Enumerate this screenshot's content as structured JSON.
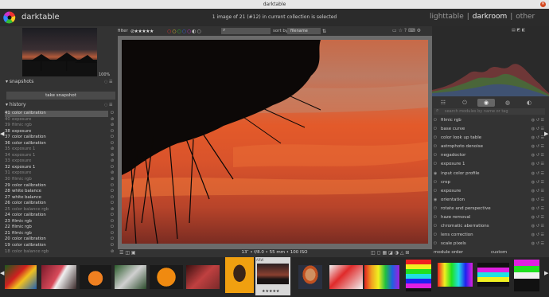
{
  "window": {
    "title": "darktable",
    "close_icon": "close-icon"
  },
  "header": {
    "app_name": "darktable",
    "info": "1 image of 21 (#12) in current collection is selected",
    "views": {
      "lighttable": "lighttable",
      "sep1": "|",
      "darkroom": "darkroom",
      "sep2": "|",
      "other": "other"
    }
  },
  "left": {
    "zoom": "100%",
    "snapshots": {
      "title": "snapshots",
      "button": "take snapshot"
    },
    "history": {
      "title": "history",
      "items": [
        {
          "num": "41",
          "name": "color calibration",
          "dim": false
        },
        {
          "num": "40",
          "name": "exposure",
          "dim": true
        },
        {
          "num": "39",
          "name": "filmic rgb",
          "dim": true
        },
        {
          "num": "38",
          "name": "exposure",
          "dim": false
        },
        {
          "num": "37",
          "name": "color calibration",
          "dim": false
        },
        {
          "num": "36",
          "name": "color calibration",
          "dim": false
        },
        {
          "num": "35",
          "name": "exposure 1",
          "dim": true
        },
        {
          "num": "34",
          "name": "exposure 1",
          "dim": true
        },
        {
          "num": "33",
          "name": "exposure",
          "dim": true
        },
        {
          "num": "32",
          "name": "exposure 1",
          "dim": false
        },
        {
          "num": "31",
          "name": "exposure",
          "dim": true
        },
        {
          "num": "30",
          "name": "filmic rgb",
          "dim": true
        },
        {
          "num": "29",
          "name": "color calibration",
          "dim": false
        },
        {
          "num": "28",
          "name": "white balance",
          "dim": false
        },
        {
          "num": "27",
          "name": "white balance",
          "dim": false
        },
        {
          "num": "26",
          "name": "color calibration",
          "dim": false
        },
        {
          "num": "25",
          "name": "color balance rgb",
          "dim": true
        },
        {
          "num": "24",
          "name": "color calibration",
          "dim": false
        },
        {
          "num": "23",
          "name": "filmic rgb",
          "dim": false
        },
        {
          "num": "22",
          "name": "filmic rgb",
          "dim": false
        },
        {
          "num": "21",
          "name": "filmic rgb",
          "dim": false
        },
        {
          "num": "20",
          "name": "color calibration",
          "dim": false
        },
        {
          "num": "19",
          "name": "color calibration",
          "dim": false
        },
        {
          "num": "18",
          "name": "color balance rgb",
          "dim": true
        }
      ]
    }
  },
  "center": {
    "filter_label": "filter",
    "stars": "⊘★★★★★",
    "sort_label": "sort by",
    "sort_value": "filename",
    "exif": "13″ • f/8.0 • 55 mm • 100 ISO"
  },
  "right": {
    "search_placeholder": "search modules by name or tag",
    "modules": [
      {
        "name": "filmic rgb",
        "on": false
      },
      {
        "name": "base curve",
        "on": false
      },
      {
        "name": "color look up table",
        "on": false
      },
      {
        "name": "astrophoto denoise",
        "on": false
      },
      {
        "name": "negadoctor",
        "on": false
      },
      {
        "name": "exposure 1",
        "on": false
      },
      {
        "name": "input color profile",
        "on": true
      },
      {
        "name": "crop",
        "on": false
      },
      {
        "name": "exposure",
        "on": false
      },
      {
        "name": "orientation",
        "on": true
      },
      {
        "name": "rotate and perspective",
        "on": false
      },
      {
        "name": "haze removal",
        "on": false
      },
      {
        "name": "chromatic aberrations",
        "on": false
      },
      {
        "name": "lens correction",
        "on": false
      },
      {
        "name": "scale pixels",
        "on": false
      }
    ],
    "module_order_label": "module order",
    "module_order_value": "custom"
  },
  "filmstrip": {
    "rating": "★★★★★"
  },
  "colors": {
    "accent": "#e5e5e5",
    "panel": "#333333",
    "center": "#6b6b6b"
  }
}
